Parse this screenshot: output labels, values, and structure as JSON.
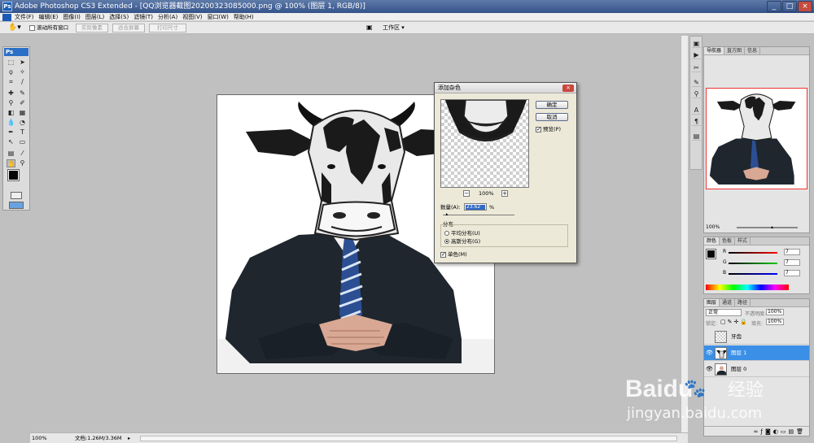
{
  "window": {
    "title": "Adobe Photoshop CS3 Extended - [QQ浏览器截图20200323085000.png @ 100% (图层 1, RGB/8)]",
    "app_icon": "Ps",
    "controls": [
      "_",
      "□",
      "×"
    ]
  },
  "menu": {
    "items": [
      "文件(F)",
      "编辑(E)",
      "图像(I)",
      "图层(L)",
      "选择(S)",
      "滤镜(T)",
      "分析(A)",
      "视图(V)",
      "窗口(W)",
      "帮助(H)"
    ]
  },
  "options_bar": {
    "scroll_all_windows": "滚动所有窗口",
    "actual_pixels": "实际像素",
    "fit_screen": "适合屏幕",
    "print_size": "打印尺寸",
    "workspace": "工作区 ▾"
  },
  "toolbox": {
    "logo": "Ps"
  },
  "status": {
    "zoom": "100%",
    "doc_size": "文档:1.26M/3.36M"
  },
  "dialog": {
    "title": "添加杂色",
    "close": "×",
    "ok": "确定",
    "cancel": "取消",
    "preview_label": "预览(P)",
    "preview_checked": true,
    "preview_zoom": "100%",
    "zoom_out": "−",
    "zoom_in": "+",
    "amount_label": "数量(A):",
    "amount_value": "23.62",
    "amount_unit": "%",
    "amount_fraction": 0.06,
    "distribution_title": "分布",
    "uniform": "平均分布(U)",
    "gaussian": "高斯分布(G)",
    "selected_distribution": "gaussian",
    "monochromatic": "单色(M)",
    "monochromatic_checked": true
  },
  "navigator": {
    "tabs": [
      "导航器",
      "直方图",
      "信息"
    ],
    "zoom": "100%"
  },
  "color_panel": {
    "tabs": [
      "颜色",
      "色板",
      "样式"
    ],
    "r_label": "R",
    "g_label": "G",
    "b_label": "B",
    "r": "7",
    "g": "7",
    "b": "7",
    "foreground": "#070707"
  },
  "layers_panel": {
    "tabs": [
      "图层",
      "通道",
      "路径"
    ],
    "blend_mode": "正常",
    "opacity_label": "不透明度:",
    "opacity": "100%",
    "lock_label": "锁定:",
    "fill_label": "填充:",
    "fill": "100%",
    "layers": [
      {
        "name": "牙齿",
        "visible": false,
        "selected": false
      },
      {
        "name": "图层 1",
        "visible": true,
        "selected": true
      },
      {
        "name": "图层 0",
        "visible": true,
        "selected": false
      }
    ]
  },
  "watermark": {
    "brand": "Baidu",
    "cn": "经验",
    "url": "jingyan.baidu.com"
  }
}
